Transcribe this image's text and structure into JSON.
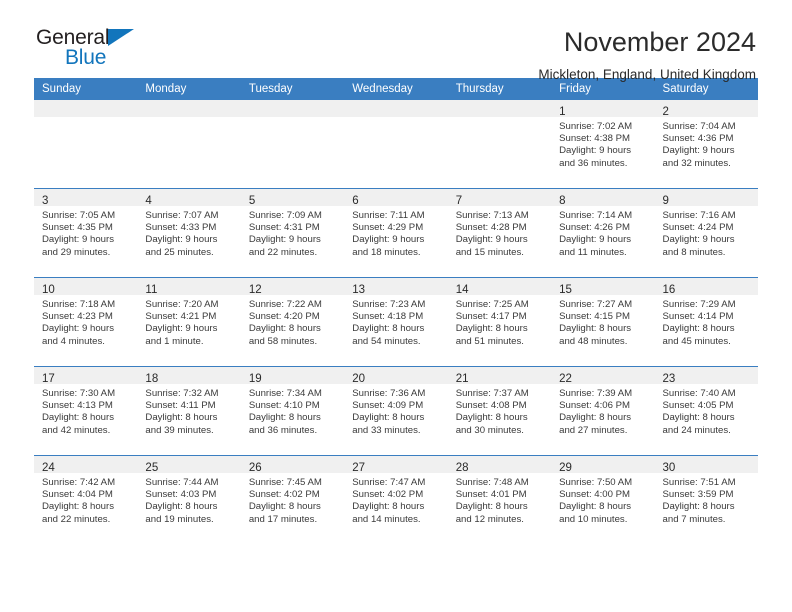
{
  "brand": {
    "name_top": "General",
    "name_bottom": "Blue",
    "accent_color": "#1275bc"
  },
  "header": {
    "title": "November 2024",
    "subtitle": "Mickleton, England, United Kingdom"
  },
  "theme": {
    "header_row_color": "#3a7ec1",
    "daynum_band_color": "#f0f0f0",
    "text_color": "#2a2a2a"
  },
  "weekday_headers": [
    "Sunday",
    "Monday",
    "Tuesday",
    "Wednesday",
    "Thursday",
    "Friday",
    "Saturday"
  ],
  "weeks": [
    [
      {
        "day": "",
        "lines": []
      },
      {
        "day": "",
        "lines": []
      },
      {
        "day": "",
        "lines": []
      },
      {
        "day": "",
        "lines": []
      },
      {
        "day": "",
        "lines": []
      },
      {
        "day": "1",
        "lines": [
          "Sunrise: 7:02 AM",
          "Sunset: 4:38 PM",
          "Daylight: 9 hours",
          "and 36 minutes."
        ]
      },
      {
        "day": "2",
        "lines": [
          "Sunrise: 7:04 AM",
          "Sunset: 4:36 PM",
          "Daylight: 9 hours",
          "and 32 minutes."
        ]
      }
    ],
    [
      {
        "day": "3",
        "lines": [
          "Sunrise: 7:05 AM",
          "Sunset: 4:35 PM",
          "Daylight: 9 hours",
          "and 29 minutes."
        ]
      },
      {
        "day": "4",
        "lines": [
          "Sunrise: 7:07 AM",
          "Sunset: 4:33 PM",
          "Daylight: 9 hours",
          "and 25 minutes."
        ]
      },
      {
        "day": "5",
        "lines": [
          "Sunrise: 7:09 AM",
          "Sunset: 4:31 PM",
          "Daylight: 9 hours",
          "and 22 minutes."
        ]
      },
      {
        "day": "6",
        "lines": [
          "Sunrise: 7:11 AM",
          "Sunset: 4:29 PM",
          "Daylight: 9 hours",
          "and 18 minutes."
        ]
      },
      {
        "day": "7",
        "lines": [
          "Sunrise: 7:13 AM",
          "Sunset: 4:28 PM",
          "Daylight: 9 hours",
          "and 15 minutes."
        ]
      },
      {
        "day": "8",
        "lines": [
          "Sunrise: 7:14 AM",
          "Sunset: 4:26 PM",
          "Daylight: 9 hours",
          "and 11 minutes."
        ]
      },
      {
        "day": "9",
        "lines": [
          "Sunrise: 7:16 AM",
          "Sunset: 4:24 PM",
          "Daylight: 9 hours",
          "and 8 minutes."
        ]
      }
    ],
    [
      {
        "day": "10",
        "lines": [
          "Sunrise: 7:18 AM",
          "Sunset: 4:23 PM",
          "Daylight: 9 hours",
          "and 4 minutes."
        ]
      },
      {
        "day": "11",
        "lines": [
          "Sunrise: 7:20 AM",
          "Sunset: 4:21 PM",
          "Daylight: 9 hours",
          "and 1 minute."
        ]
      },
      {
        "day": "12",
        "lines": [
          "Sunrise: 7:22 AM",
          "Sunset: 4:20 PM",
          "Daylight: 8 hours",
          "and 58 minutes."
        ]
      },
      {
        "day": "13",
        "lines": [
          "Sunrise: 7:23 AM",
          "Sunset: 4:18 PM",
          "Daylight: 8 hours",
          "and 54 minutes."
        ]
      },
      {
        "day": "14",
        "lines": [
          "Sunrise: 7:25 AM",
          "Sunset: 4:17 PM",
          "Daylight: 8 hours",
          "and 51 minutes."
        ]
      },
      {
        "day": "15",
        "lines": [
          "Sunrise: 7:27 AM",
          "Sunset: 4:15 PM",
          "Daylight: 8 hours",
          "and 48 minutes."
        ]
      },
      {
        "day": "16",
        "lines": [
          "Sunrise: 7:29 AM",
          "Sunset: 4:14 PM",
          "Daylight: 8 hours",
          "and 45 minutes."
        ]
      }
    ],
    [
      {
        "day": "17",
        "lines": [
          "Sunrise: 7:30 AM",
          "Sunset: 4:13 PM",
          "Daylight: 8 hours",
          "and 42 minutes."
        ]
      },
      {
        "day": "18",
        "lines": [
          "Sunrise: 7:32 AM",
          "Sunset: 4:11 PM",
          "Daylight: 8 hours",
          "and 39 minutes."
        ]
      },
      {
        "day": "19",
        "lines": [
          "Sunrise: 7:34 AM",
          "Sunset: 4:10 PM",
          "Daylight: 8 hours",
          "and 36 minutes."
        ]
      },
      {
        "day": "20",
        "lines": [
          "Sunrise: 7:36 AM",
          "Sunset: 4:09 PM",
          "Daylight: 8 hours",
          "and 33 minutes."
        ]
      },
      {
        "day": "21",
        "lines": [
          "Sunrise: 7:37 AM",
          "Sunset: 4:08 PM",
          "Daylight: 8 hours",
          "and 30 minutes."
        ]
      },
      {
        "day": "22",
        "lines": [
          "Sunrise: 7:39 AM",
          "Sunset: 4:06 PM",
          "Daylight: 8 hours",
          "and 27 minutes."
        ]
      },
      {
        "day": "23",
        "lines": [
          "Sunrise: 7:40 AM",
          "Sunset: 4:05 PM",
          "Daylight: 8 hours",
          "and 24 minutes."
        ]
      }
    ],
    [
      {
        "day": "24",
        "lines": [
          "Sunrise: 7:42 AM",
          "Sunset: 4:04 PM",
          "Daylight: 8 hours",
          "and 22 minutes."
        ]
      },
      {
        "day": "25",
        "lines": [
          "Sunrise: 7:44 AM",
          "Sunset: 4:03 PM",
          "Daylight: 8 hours",
          "and 19 minutes."
        ]
      },
      {
        "day": "26",
        "lines": [
          "Sunrise: 7:45 AM",
          "Sunset: 4:02 PM",
          "Daylight: 8 hours",
          "and 17 minutes."
        ]
      },
      {
        "day": "27",
        "lines": [
          "Sunrise: 7:47 AM",
          "Sunset: 4:02 PM",
          "Daylight: 8 hours",
          "and 14 minutes."
        ]
      },
      {
        "day": "28",
        "lines": [
          "Sunrise: 7:48 AM",
          "Sunset: 4:01 PM",
          "Daylight: 8 hours",
          "and 12 minutes."
        ]
      },
      {
        "day": "29",
        "lines": [
          "Sunrise: 7:50 AM",
          "Sunset: 4:00 PM",
          "Daylight: 8 hours",
          "and 10 minutes."
        ]
      },
      {
        "day": "30",
        "lines": [
          "Sunrise: 7:51 AM",
          "Sunset: 3:59 PM",
          "Daylight: 8 hours",
          "and 7 minutes."
        ]
      }
    ]
  ]
}
